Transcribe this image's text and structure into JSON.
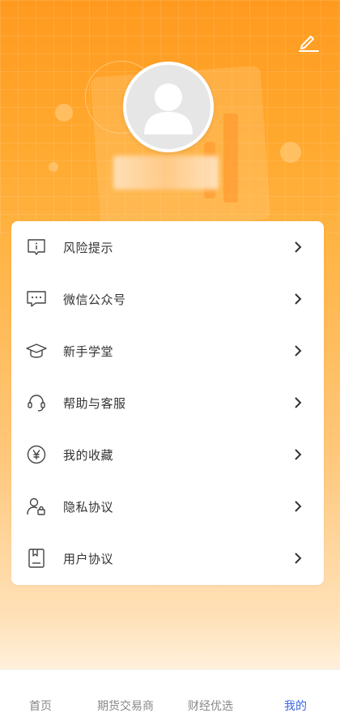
{
  "header": {
    "edit_icon": "pencil-edit-icon",
    "avatar_icon": "user-avatar-icon",
    "username": ""
  },
  "menu": {
    "items": [
      {
        "label": "风险提示",
        "icon": "risk-notice-icon"
      },
      {
        "label": "微信公众号",
        "icon": "wechat-chat-icon"
      },
      {
        "label": "新手学堂",
        "icon": "graduation-cap-icon"
      },
      {
        "label": "帮助与客服",
        "icon": "headset-icon"
      },
      {
        "label": "我的收藏",
        "icon": "yen-coin-icon"
      },
      {
        "label": "隐私协议",
        "icon": "user-lock-icon"
      },
      {
        "label": "用户协议",
        "icon": "document-bookmark-icon"
      }
    ]
  },
  "tabbar": {
    "tabs": [
      {
        "label": "首页",
        "active": false
      },
      {
        "label": "期货交易商",
        "active": false
      },
      {
        "label": "财经优选",
        "active": false
      },
      {
        "label": "我的",
        "active": true
      }
    ]
  },
  "colors": {
    "header_orange": "#ff9a1f",
    "active_tab": "#3a66e6",
    "text": "#333333",
    "inactive_tab": "#888888"
  }
}
